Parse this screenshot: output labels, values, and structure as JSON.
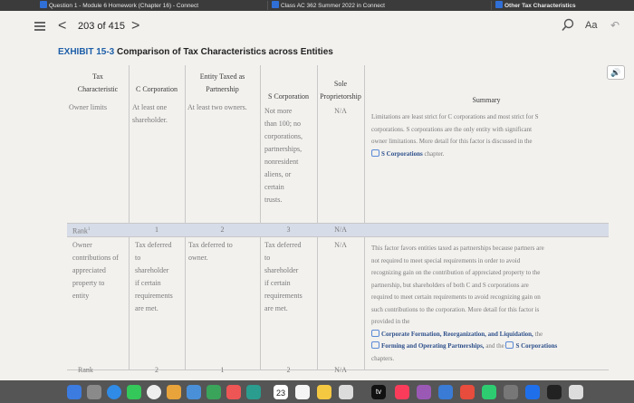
{
  "browser_tabs": [
    {
      "label": "Question 1 - Module 6 Homework (Chapter 16) - Connect"
    },
    {
      "label": "Class AC 362 Summer 2022 in Connect"
    },
    {
      "label": "Other Tax Characteristics"
    }
  ],
  "nav": {
    "back": "<",
    "page_count": "203 of 415",
    "forward": ">",
    "text_size": "Aa",
    "undo": "↶"
  },
  "exhibit": {
    "number": "EXHIBIT 15-3",
    "title": "Comparison of Tax Characteristics across Entities"
  },
  "audio_icon": "🔊",
  "table": {
    "headers": {
      "tax_char": [
        "Tax",
        "Characteristic"
      ],
      "c_corp": "C Corporation",
      "partnership": [
        "Entity Taxed as",
        "Partnership"
      ],
      "s_corp": "S Corporation",
      "sole_prop": [
        "Sole",
        "Proprietorship"
      ],
      "summary": "Summary"
    },
    "row1": {
      "label": "Owner limits",
      "c_corp": [
        "At least one",
        "shareholder."
      ],
      "partnership": "At least two owners.",
      "s_corp": [
        "Not more",
        "than 100; no",
        "corporations,",
        "partnerships,",
        "nonresident",
        "aliens, or",
        "certain",
        "trusts."
      ],
      "sole_prop": "N/A",
      "summary": [
        "Limitations are least strict for C corporations and most strict for S",
        "corporations. S corporations are the only entity with significant",
        "owner limitations. More detail for this factor is discussed in the"
      ],
      "summary_link": "S Corporations",
      "summary_tail": " chapter."
    },
    "rank1": {
      "label": "Rank",
      "sup": "1",
      "c_corp": "1",
      "partnership": "2",
      "s_corp": "3",
      "sole_prop": "N/A"
    },
    "row2": {
      "label": [
        "Owner",
        "contributions of",
        "appreciated",
        "property to",
        "entity"
      ],
      "c_corp": [
        "Tax deferred",
        "to",
        "shareholder",
        "if certain",
        "requirements",
        "are met."
      ],
      "partnership": [
        "Tax deferred to",
        "owner."
      ],
      "s_corp": [
        "Tax deferred",
        "to",
        "shareholder",
        "if certain",
        "requirements",
        "are met."
      ],
      "sole_prop": "N/A",
      "summary": [
        "This factor favors entities taxed as partnerships because partners are",
        "not required to meet special requirements in order to avoid",
        "recognizing gain on the contribution of appreciated property to the",
        "partnership, but shareholders of both C and S corporations are",
        "required to meet certain requirements to avoid recognizing gain on",
        "such contributions to the corporation. More detail for this factor is",
        "provided in the"
      ],
      "link1": "Corporate Formation, Reorganization, and Liquidation,",
      "link1_tail": " the",
      "link2": "Forming and Operating Partnerships,",
      "link2_mid": " and the ",
      "link3": "S Corporations",
      "chapters": "chapters."
    },
    "rank2": {
      "label": "Rank",
      "c_corp": "2",
      "partnership": "1",
      "s_corp": "2",
      "sole_prop": "N/A"
    }
  },
  "dock": {
    "calendar_day": "23",
    "tv_label": "tv"
  }
}
